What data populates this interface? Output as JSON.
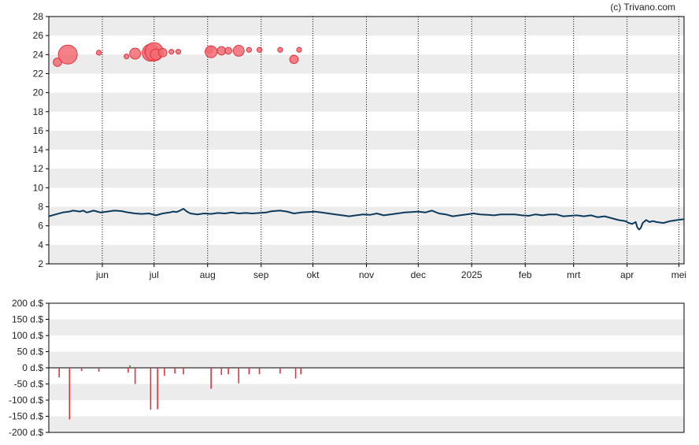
{
  "credit": "(c) Trivano.com",
  "colors": {
    "price_line": "#0d3b5e",
    "bubble_fill": "#f26b73",
    "bubble_stroke": "#e2333f",
    "bar_sell": "#e2333f",
    "bar_buy": "#2e8b57",
    "band": "#ececec",
    "grid": "#000000"
  },
  "chart_data": [
    {
      "type": "line",
      "title": "",
      "xlabel": "",
      "ylabel": "",
      "ylim": [
        2,
        28
      ],
      "y_ticks": [
        2,
        4,
        6,
        8,
        10,
        12,
        14,
        16,
        18,
        20,
        22,
        24,
        26,
        28
      ],
      "y_tick_labels": [
        "2",
        "4",
        "6",
        "8",
        "10",
        "12",
        "14",
        "16",
        "18",
        "20",
        "22",
        "24",
        "26",
        "28"
      ],
      "x_range_days": [
        0,
        368
      ],
      "month_ticks": [
        {
          "label": "jun",
          "day": 31
        },
        {
          "label": "jul",
          "day": 61
        },
        {
          "label": "aug",
          "day": 92
        },
        {
          "label": "sep",
          "day": 123
        },
        {
          "label": "okt",
          "day": 153
        },
        {
          "label": "nov",
          "day": 184
        },
        {
          "label": "dec",
          "day": 214
        },
        {
          "label": "2025",
          "day": 245
        },
        {
          "label": "feb",
          "day": 276
        },
        {
          "label": "mrt",
          "day": 304
        },
        {
          "label": "apr",
          "day": 335
        },
        {
          "label": "mei",
          "day": 365
        }
      ],
      "grid": "vertical dotted at month ticks, alternating horizontal bands",
      "series": [
        {
          "x": [
            0,
            4,
            8,
            12,
            14,
            16,
            18,
            20,
            22,
            24,
            26,
            28,
            30,
            34,
            38,
            42,
            46,
            50,
            54,
            58,
            62,
            66,
            70,
            72,
            74,
            76,
            78,
            80,
            82,
            86,
            90,
            94,
            98,
            102,
            106,
            110,
            114,
            118,
            122,
            126,
            128,
            130,
            134,
            138,
            142,
            146,
            150,
            154,
            158,
            162,
            166,
            170,
            174,
            178,
            182,
            186,
            190,
            194,
            198,
            202,
            206,
            210,
            214,
            218,
            222,
            226,
            230,
            234,
            238,
            242,
            246,
            250,
            254,
            258,
            262,
            266,
            270,
            274,
            278,
            282,
            286,
            290,
            294,
            298,
            302,
            306,
            310,
            314,
            318,
            322,
            326,
            330,
            334,
            336,
            338,
            340,
            341,
            342,
            343,
            344,
            346,
            348,
            350,
            352,
            356,
            360,
            364,
            368
          ],
          "y": [
            7.0,
            7.2,
            7.4,
            7.5,
            7.6,
            7.55,
            7.5,
            7.6,
            7.4,
            7.5,
            7.6,
            7.5,
            7.4,
            7.5,
            7.6,
            7.55,
            7.4,
            7.3,
            7.25,
            7.3,
            7.1,
            7.3,
            7.4,
            7.5,
            7.45,
            7.6,
            7.8,
            7.5,
            7.3,
            7.2,
            7.3,
            7.25,
            7.35,
            7.3,
            7.4,
            7.3,
            7.35,
            7.3,
            7.35,
            7.4,
            7.5,
            7.55,
            7.6,
            7.5,
            7.3,
            7.4,
            7.45,
            7.5,
            7.4,
            7.3,
            7.2,
            7.1,
            7.0,
            7.1,
            7.2,
            7.15,
            7.3,
            7.1,
            7.2,
            7.3,
            7.4,
            7.45,
            7.5,
            7.4,
            7.6,
            7.3,
            7.2,
            7.0,
            7.1,
            7.2,
            7.3,
            7.2,
            7.15,
            7.1,
            7.2,
            7.2,
            7.2,
            7.1,
            7.05,
            7.2,
            7.1,
            7.2,
            7.2,
            7.0,
            7.05,
            7.1,
            7.0,
            7.1,
            6.9,
            7.0,
            6.8,
            6.6,
            6.5,
            6.3,
            6.2,
            6.4,
            5.8,
            5.6,
            5.8,
            6.3,
            6.6,
            6.4,
            6.5,
            6.4,
            6.3,
            6.5,
            6.6,
            6.7
          ]
        }
      ],
      "bubbles": [
        {
          "day": 5,
          "y": 23.2,
          "size": 3
        },
        {
          "day": 11,
          "y": 24.0,
          "size": 15
        },
        {
          "day": 29,
          "y": 24.2,
          "size": 1
        },
        {
          "day": 45,
          "y": 23.8,
          "size": 1
        },
        {
          "day": 50,
          "y": 24.1,
          "size": 5
        },
        {
          "day": 57,
          "y": 24.3,
          "size": 2
        },
        {
          "day": 59,
          "y": 24.2,
          "size": 12
        },
        {
          "day": 61,
          "y": 24.3,
          "size": 14
        },
        {
          "day": 62,
          "y": 24.0,
          "size": 5
        },
        {
          "day": 66,
          "y": 24.2,
          "size": 3
        },
        {
          "day": 71,
          "y": 24.3,
          "size": 1
        },
        {
          "day": 75,
          "y": 24.3,
          "size": 1
        },
        {
          "day": 93,
          "y": 24.5,
          "size": 2
        },
        {
          "day": 94,
          "y": 24.3,
          "size": 6
        },
        {
          "day": 100,
          "y": 24.4,
          "size": 3
        },
        {
          "day": 104,
          "y": 24.4,
          "size": 2
        },
        {
          "day": 110,
          "y": 24.4,
          "size": 5
        },
        {
          "day": 116,
          "y": 24.5,
          "size": 1
        },
        {
          "day": 122,
          "y": 24.5,
          "size": 1
        },
        {
          "day": 134,
          "y": 24.5,
          "size": 1
        },
        {
          "day": 142,
          "y": 23.5,
          "size": 3
        },
        {
          "day": 145,
          "y": 24.5,
          "size": 1
        }
      ]
    },
    {
      "type": "bar",
      "title": "",
      "xlabel": "",
      "ylabel": "",
      "ylim": [
        -200,
        200
      ],
      "y_ticks": [
        -200,
        -150,
        -100,
        -50,
        0,
        50,
        100,
        150,
        200
      ],
      "y_tick_labels": [
        "-200 d.$",
        "-150 d.$",
        "-100 d.$",
        "-50 d.$",
        "0 d.$",
        "50 d.$",
        "100 d.$",
        "150 d.$",
        "200 d.$"
      ],
      "x_range_days": [
        0,
        368
      ],
      "grid": "alternating horizontal bands",
      "bars": [
        {
          "day": 6,
          "value": -30
        },
        {
          "day": 12,
          "value": -160
        },
        {
          "day": 19,
          "value": -10
        },
        {
          "day": 29,
          "value": -12
        },
        {
          "day": 46,
          "value": -15
        },
        {
          "day": 47,
          "value": 8
        },
        {
          "day": 50,
          "value": -50
        },
        {
          "day": 59,
          "value": -130
        },
        {
          "day": 63,
          "value": -128
        },
        {
          "day": 67,
          "value": -25
        },
        {
          "day": 73,
          "value": -18
        },
        {
          "day": 78,
          "value": -20
        },
        {
          "day": 94,
          "value": -65
        },
        {
          "day": 100,
          "value": -22
        },
        {
          "day": 104,
          "value": -20
        },
        {
          "day": 110,
          "value": -48
        },
        {
          "day": 116,
          "value": -20
        },
        {
          "day": 122,
          "value": -20
        },
        {
          "day": 134,
          "value": -18
        },
        {
          "day": 143,
          "value": -33
        },
        {
          "day": 146,
          "value": -20
        }
      ]
    }
  ]
}
